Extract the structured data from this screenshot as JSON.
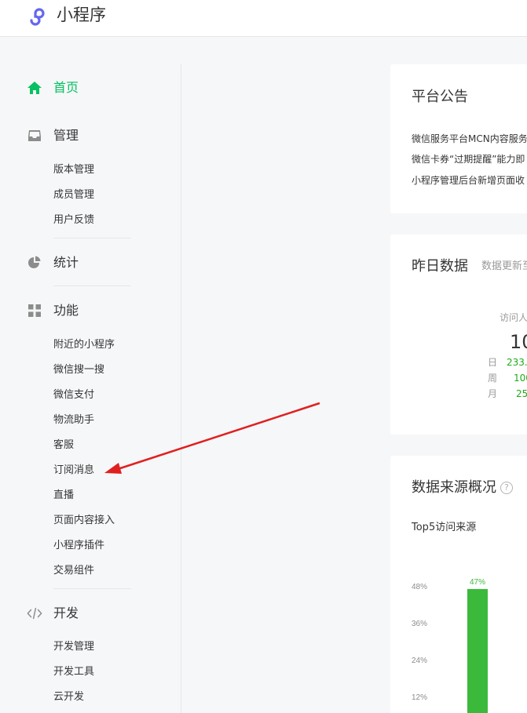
{
  "app": {
    "title": "小程序"
  },
  "sidebar": {
    "home": "首页",
    "manage": {
      "label": "管理",
      "items": [
        "版本管理",
        "成员管理",
        "用户反馈"
      ]
    },
    "stats": "统计",
    "features": {
      "label": "功能",
      "items": [
        "附近的小程序",
        "微信搜一搜",
        "微信支付",
        "物流助手",
        "客服",
        "订阅消息",
        "直播",
        "页面内容接入",
        "小程序插件",
        "交易组件"
      ]
    },
    "dev": {
      "label": "开发",
      "items": [
        "开发管理",
        "开发工具",
        "云开发"
      ]
    }
  },
  "announcements": {
    "title": "平台公告",
    "items": [
      "微信服务平台MCN内容服务",
      "微信卡券“过期提醒”能力即",
      "小程序管理后台新增页面收"
    ]
  },
  "yesterday": {
    "title": "昨日数据",
    "note": "数据更新至",
    "metric_label": "访问人",
    "metric_value": "10",
    "rows": [
      {
        "label": "日",
        "value": "233."
      },
      {
        "label": "周",
        "value": "100"
      },
      {
        "label": "月",
        "value": "25"
      }
    ]
  },
  "source": {
    "title": "数据来源概况",
    "subtitle": "Top5访问来源"
  },
  "chart_data": {
    "type": "bar",
    "categories": [
      ""
    ],
    "values": [
      47
    ],
    "data_labels": [
      "47%"
    ],
    "y_ticks": [
      "12%",
      "24%",
      "36%",
      "48%"
    ],
    "ylim": [
      0,
      48
    ],
    "bar_color": "#3bb93b"
  },
  "colors": {
    "accent": "#07c160",
    "arrow": "#e02020"
  }
}
